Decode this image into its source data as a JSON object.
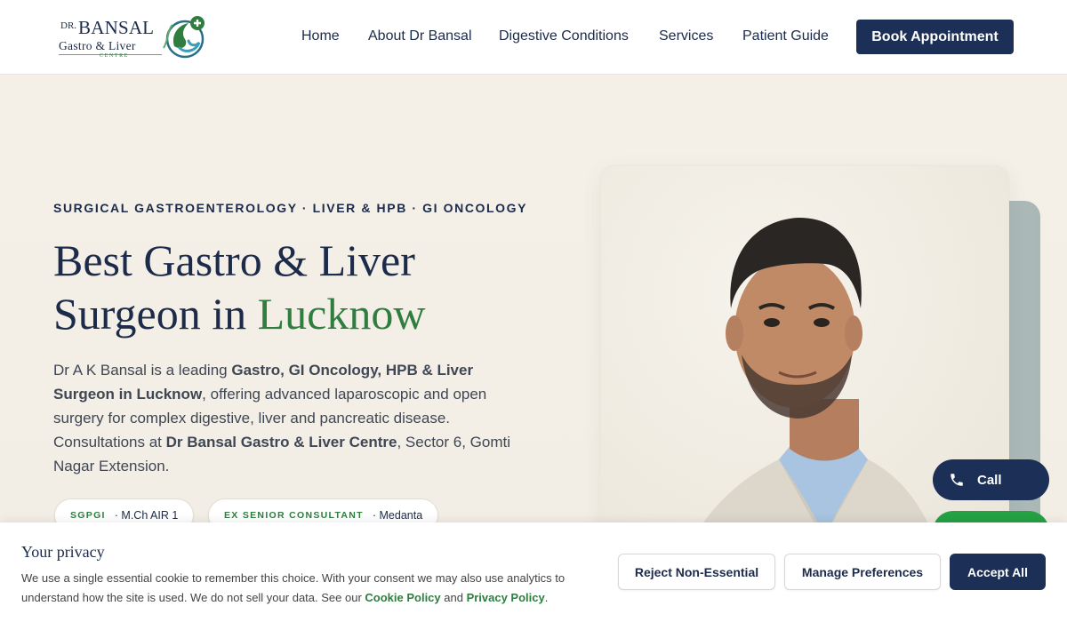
{
  "brand": {
    "prefix": "DR.",
    "name": "BANSAL",
    "line2": "Gastro & Liver",
    "line3": "CENTRE"
  },
  "nav": {
    "items": [
      "Home",
      "About Dr Bansal",
      "Digestive Conditions",
      "Services",
      "Patient Guide"
    ],
    "cta": "Book Appointment"
  },
  "hero": {
    "eyebrow": "SURGICAL GASTROENTEROLOGY · LIVER & HPB · GI ONCOLOGY",
    "title_line1": "Best Gastro & Liver",
    "title_line2_plain": "Surgeon in ",
    "title_line2_accent": "Lucknow",
    "intro": {
      "t1": "Dr A K Bansal is a leading ",
      "b1": "Gastro, GI Oncology, HPB & Liver Surgeon in Lucknow",
      "t2": ", offering advanced laparoscopic and open surgery for complex digestive, liver and pancreatic disease. Consultations at ",
      "b2": "Dr Bansal Gastro & Liver Centre",
      "t3": ", Sector 6, Gomti Nagar Extension."
    },
    "chips": [
      {
        "key": "SGPGI",
        "value": "· M.Ch AIR 1"
      },
      {
        "key": "EX SENIOR CONSULTANT",
        "value": "· Medanta"
      }
    ]
  },
  "floating": {
    "call_label": "Call"
  },
  "cookie": {
    "title": "Your privacy",
    "text": "We use a single essential cookie to remember this choice. With your consent we may also use analytics to understand how the site is used. We do not sell your data. See our ",
    "cookie_policy": "Cookie Policy",
    "and": " and ",
    "privacy_policy": "Privacy Policy",
    "end": ".",
    "reject": "Reject Non-Essential",
    "manage": "Manage Preferences",
    "accept": "Accept All"
  },
  "colors": {
    "navy": "#1b2f57",
    "green": "#2f7d3f",
    "whatsapp": "#25a244",
    "background": "#f3efe6"
  },
  "icons": [
    "gastro-logo-icon",
    "phone-icon"
  ]
}
